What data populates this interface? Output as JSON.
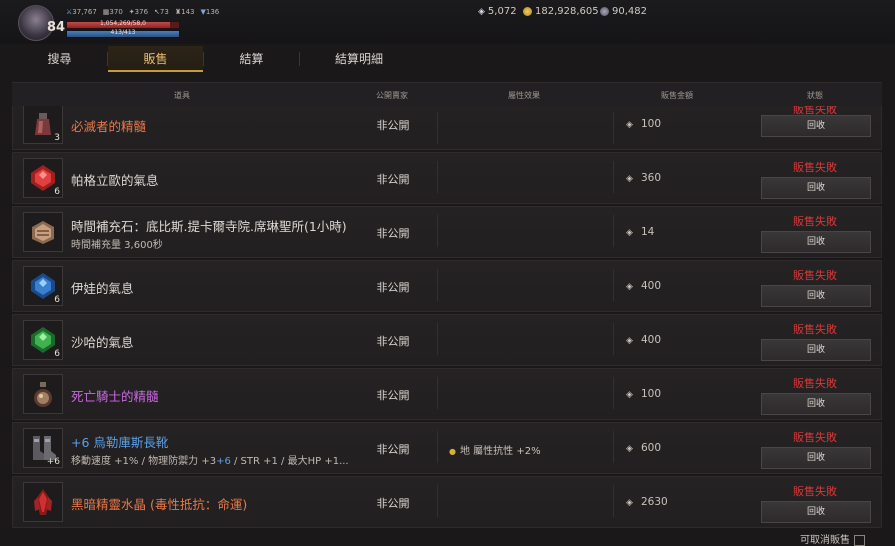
{
  "player": {
    "level": "84",
    "stats": [
      "37,767",
      "370",
      "376",
      "73",
      "143",
      "136"
    ],
    "hp_text": "1,054,269/58,0",
    "hp_fill": 0.92,
    "mp_text": "413/413",
    "mp_fill": 1.0
  },
  "currency": {
    "gems": "5,072",
    "gold": "182,928,605",
    "points": "90,482"
  },
  "tabs": [
    {
      "label": "搜尋",
      "active": false
    },
    {
      "label": "販售",
      "active": true
    },
    {
      "label": "結算",
      "active": false
    },
    {
      "label": "結算明細",
      "active": false
    }
  ],
  "columns": {
    "item": "道具",
    "seller": "公開賣家",
    "attribute": "屬性效果",
    "price": "販售金額",
    "status": "狀態"
  },
  "rows": [
    {
      "name": "必滅者的精髓",
      "name_color": "#e8774a",
      "sub": "",
      "qty": "3",
      "seller": "非公開",
      "attribute": "",
      "price": "100",
      "status": "販售失敗",
      "button": "回收",
      "icon": "essence-bottle-icon"
    },
    {
      "name": "帕格立歐的氣息",
      "name_color": "#dcd8d2",
      "sub": "",
      "qty": "6",
      "seller": "非公開",
      "attribute": "",
      "price": "360",
      "status": "販售失敗",
      "button": "回收",
      "icon": "red-gem-icon"
    },
    {
      "name": "時間補充石：底比斯.提卡爾寺院.席琳聖所(1小時)",
      "name_color": "#dcd8d2",
      "sub": "時間補充量 3,600秒",
      "qty": "",
      "seller": "非公開",
      "attribute": "",
      "price": "14",
      "status": "販售失敗",
      "button": "回收",
      "icon": "time-stone-icon"
    },
    {
      "name": "伊娃的氣息",
      "name_color": "#dcd8d2",
      "sub": "",
      "qty": "6",
      "seller": "非公開",
      "attribute": "",
      "price": "400",
      "status": "販售失敗",
      "button": "回收",
      "icon": "blue-gem-icon"
    },
    {
      "name": "沙哈的氣息",
      "name_color": "#dcd8d2",
      "sub": "",
      "qty": "6",
      "seller": "非公開",
      "attribute": "",
      "price": "400",
      "status": "販售失敗",
      "button": "回收",
      "icon": "green-gem-icon"
    },
    {
      "name": "死亡騎士的精髓",
      "name_color": "#c868e0",
      "sub": "",
      "qty": "",
      "seller": "非公開",
      "attribute": "",
      "price": "100",
      "status": "販售失敗",
      "button": "回收",
      "icon": "purple-essence-icon"
    },
    {
      "name": "+6 烏勒庫斯長靴",
      "name_color": "#5aa0e8",
      "sub_parts": [
        "移動速度 +1% / 物理防禦力 +3",
        "+6",
        " / STR +1 / 最大HP +1..."
      ],
      "qty": "+6",
      "seller": "非公開",
      "attribute": "地 屬性抗性 +2%",
      "price": "600",
      "status": "販售失敗",
      "button": "回收",
      "icon": "boots-icon"
    },
    {
      "name": "黑暗精靈水晶 (毒性抵抗：命運)",
      "name_color": "#e8774a",
      "sub": "",
      "qty": "",
      "seller": "非公開",
      "attribute": "",
      "price": "2630",
      "status": "販售失敗",
      "button": "回收",
      "icon": "dark-crystal-icon"
    }
  ],
  "footer": {
    "label": "可取消販售"
  }
}
